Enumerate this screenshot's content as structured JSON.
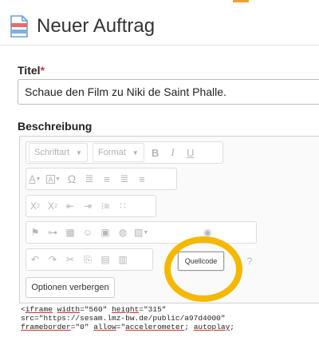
{
  "page": {
    "title": "Neuer Auftrag"
  },
  "form": {
    "title_label": "Titel",
    "required_marker": "*",
    "title_value": "Schaue den Film zu Niki de Saint Phalle.",
    "description_label": "Beschreibung"
  },
  "editor": {
    "font_dropdown": "Schriftart",
    "format_dropdown": "Format",
    "bold": "B",
    "italic": "I",
    "underline": "U",
    "source_button": "Quellcode",
    "hide_options_button": "Optionen verbergen",
    "icons": {
      "row2": [
        "text-color-icon",
        "background-color-icon",
        "omega-icon",
        "align-left-icon",
        "align-center-icon",
        "align-right-icon",
        "justify-icon"
      ],
      "row3": [
        "subscript-icon",
        "superscript-icon",
        "outdent-icon",
        "indent-icon",
        "ordered-list-icon",
        "unordered-list-icon"
      ],
      "row4": [
        "flag-icon",
        "link-icon",
        "table-icon",
        "emoji-icon",
        "calendar-icon",
        "globe-icon",
        "image-icon",
        "media-icon"
      ],
      "row5": [
        "undo-icon",
        "redo-icon",
        "cut-icon",
        "copy-icon",
        "paste-icon",
        "paste-text-icon",
        "help-icon"
      ]
    }
  },
  "source_code": {
    "line1_tag": "iframe",
    "line1_attr1": "width",
    "line1_val1": "\"560\"",
    "line1_attr2": "height",
    "line1_val2": "\"315\"",
    "line2": "src=\"https://sesam.lmz-bw.de/public/a97d4000\"",
    "line3_attr1": "frameborder",
    "line3_val1": "=\"0\"",
    "line3_attr2": "allow",
    "line3_val2_a": "=\"",
    "line3_val2_b": "accelerometer",
    "line3_val2_c": ";",
    "line3_val2_d": "autoplay",
    "line3_val2_e": ";"
  },
  "colors": {
    "highlight_ring": "#f5b800",
    "required": "#c0392b",
    "top_accent": "#f0a030"
  }
}
